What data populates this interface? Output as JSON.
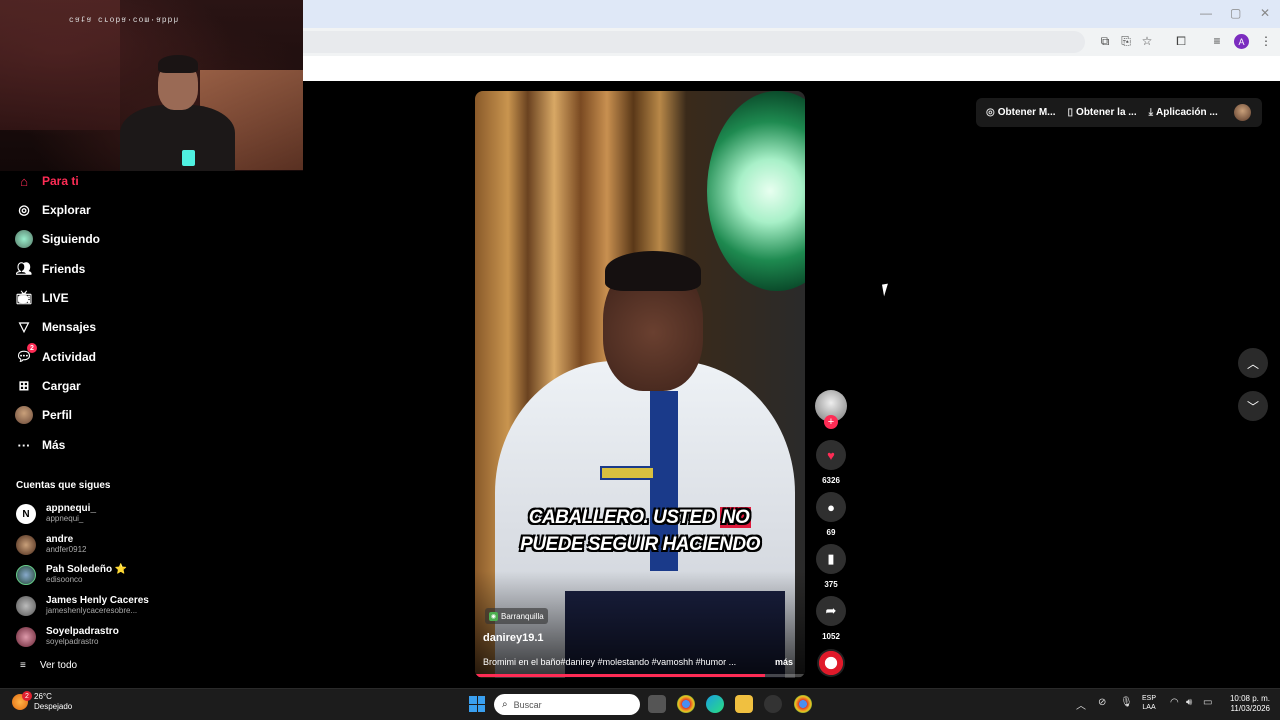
{
  "webcam": {
    "overlay_text": "ɥqqɐ·ɯoɔ·ɐqoɹɔ ɐʇɐɔ"
  },
  "sidebar": {
    "items": [
      {
        "label": "Para ti",
        "icon": "home-icon",
        "active": true
      },
      {
        "label": "Explorar",
        "icon": "compass-icon"
      },
      {
        "label": "Siguiendo",
        "icon": "avatar-icon"
      },
      {
        "label": "Friends",
        "icon": "friends-icon"
      },
      {
        "label": "LIVE",
        "icon": "live-icon"
      },
      {
        "label": "Mensajes",
        "icon": "messages-icon"
      },
      {
        "label": "Actividad",
        "icon": "activity-icon",
        "badge": "2"
      },
      {
        "label": "Cargar",
        "icon": "upload-icon"
      },
      {
        "label": "Perfil",
        "icon": "profile-avatar-icon"
      },
      {
        "label": "Más",
        "icon": "more-icon"
      }
    ],
    "following_title": "Cuentas que sigues",
    "following": [
      {
        "name": "appnequi_",
        "handle": "appnequi_"
      },
      {
        "name": "andre",
        "handle": "andfer0912"
      },
      {
        "name": "Pah Soledeño ⭐",
        "handle": "edisoonco"
      },
      {
        "name": "James Henly Caceres",
        "handle": "jameshenlycaceresobre..."
      },
      {
        "name": "Soyelpadrastro",
        "handle": "soyelpadrastro"
      }
    ],
    "see_all": "Ver todo"
  },
  "video": {
    "caption_line1_a": "CABALLERO. USTED",
    "caption_line1_b": "NO",
    "caption_line2": "PUEDE SEGUIR HACIENDO",
    "location": "Barranquilla",
    "username": "danirey19.1",
    "description": "Bromimi en el baño#danirey #molestando #vamoshh #humor ...",
    "more": "más",
    "progress": 0.88
  },
  "actions": {
    "likes": "6326",
    "comments": "69",
    "saves": "375",
    "shares": "1052"
  },
  "top_bar": {
    "pill1": "Obtener M...",
    "pill2": "Obtener la ...",
    "pill3": "Aplicación ..."
  },
  "browser": {
    "profile_initial": "A"
  },
  "taskbar": {
    "temp": "26°C",
    "weather": "Despejado",
    "weather_badge": "2",
    "search_placeholder": "Buscar",
    "lang1": "ESP",
    "lang2": "LAA",
    "time": "10:08 p. m.",
    "date": "11/03/2026"
  },
  "colors": {
    "accent": "#fe2c55",
    "background": "#000000"
  }
}
